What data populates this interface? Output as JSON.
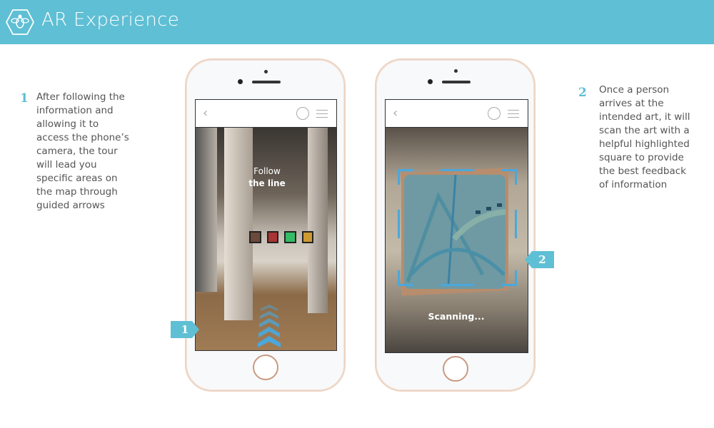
{
  "header": {
    "title": "AR Experience",
    "logo_icon": "bee-hexagon-icon",
    "color": "#5fbfd4"
  },
  "steps": [
    {
      "number": "1",
      "text": "After following the\ninformation and\nallowing it to\naccess the phone’s\ncamera, the tour\nwill lead you\nspecific areas on\nthe map through\nguided arrows"
    },
    {
      "number": "2",
      "text": "Once a person\narrives at the\nintended art, it will\nscan the art with a\nhelpful highlighted\nsquare to provide\nthe best feedback\nof  information"
    }
  ],
  "phone1": {
    "overlay_line1": "Follow",
    "overlay_line2": "the line",
    "badge": "1"
  },
  "phone2": {
    "status": "Scanning...",
    "badge": "2"
  },
  "icons": {
    "back": "chevron-left-icon",
    "user": "user-circle-icon",
    "menu": "hamburger-menu-icon"
  }
}
